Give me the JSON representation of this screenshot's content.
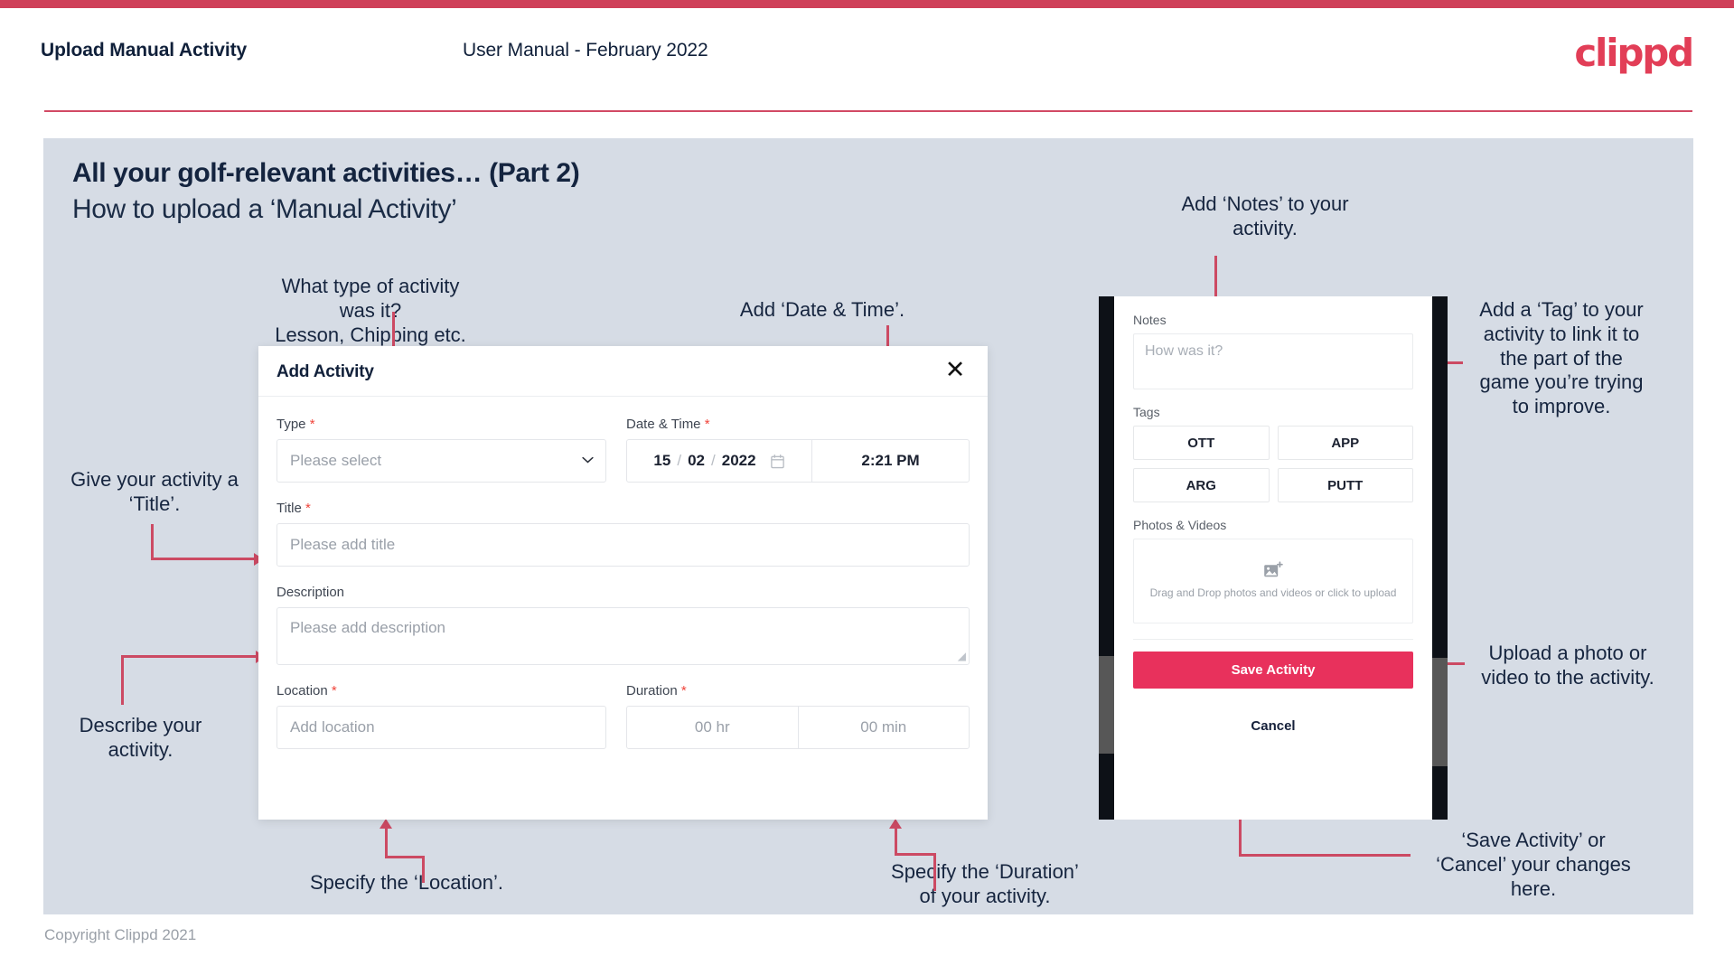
{
  "header": {
    "title": "Upload Manual Activity",
    "subtitle": "User Manual - February 2022",
    "brand": "clippd",
    "accent_color": "#cf4059"
  },
  "slide": {
    "title": "All your golf-relevant activities… (Part 2)",
    "subtitle": "How to upload a ‘Manual Activity’",
    "background_color": "#d6dce5"
  },
  "dialog": {
    "title": "Add Activity",
    "close_icon": "close-icon",
    "fields": {
      "type": {
        "label": "Type",
        "required_marker": "*",
        "placeholder": "Please select",
        "caret_icon": "chevron-down-icon"
      },
      "datetime": {
        "label": "Date & Time",
        "required_marker": "*",
        "day": "15",
        "month": "02",
        "year": "2022",
        "sep": "/",
        "calendar_icon": "calendar-icon",
        "time": "2:21 PM"
      },
      "title": {
        "label": "Title",
        "required_marker": "*",
        "placeholder": "Please add title"
      },
      "description": {
        "label": "Description",
        "required_marker": "",
        "placeholder": "Please add description",
        "resize_grip_icon": "resize-grip-icon"
      },
      "location": {
        "label": "Location",
        "required_marker": "*",
        "placeholder": "Add location"
      },
      "duration": {
        "label": "Duration",
        "required_marker": "*",
        "hours_placeholder": "00 hr",
        "minutes_placeholder": "00 min"
      }
    }
  },
  "phone": {
    "notes": {
      "label": "Notes",
      "placeholder": "How was it?"
    },
    "tags": {
      "label": "Tags",
      "items": [
        "OTT",
        "APP",
        "ARG",
        "PUTT"
      ]
    },
    "photos": {
      "label": "Photos & Videos",
      "dropzone_icon": "image-add-icon",
      "dropzone_text": "Drag and Drop photos and videos or click to upload"
    },
    "save_label": "Save Activity",
    "save_color": "#e8315c",
    "cancel_label": "Cancel"
  },
  "annotations": {
    "type": "What type of activity was it?\nLesson, Chipping etc.",
    "datetime": "Add ‘Date & Time’.",
    "title": "Give your activity a\n‘Title’.",
    "description": "Describe your\nactivity.",
    "location": "Specify the ‘Location’.",
    "duration": "Specify the ‘Duration’\nof your activity.",
    "notes": "Add ‘Notes’ to your\nactivity.",
    "tags": "Add a ‘Tag’ to your\nactivity to link it to\nthe part of the\ngame you’re trying\nto improve.",
    "photos": "Upload a photo or\nvideo to the activity.",
    "save_cancel": "‘Save Activity’ or\n‘Cancel’ your changes\nhere."
  },
  "footer": {
    "copyright": "Copyright Clippd 2021"
  }
}
